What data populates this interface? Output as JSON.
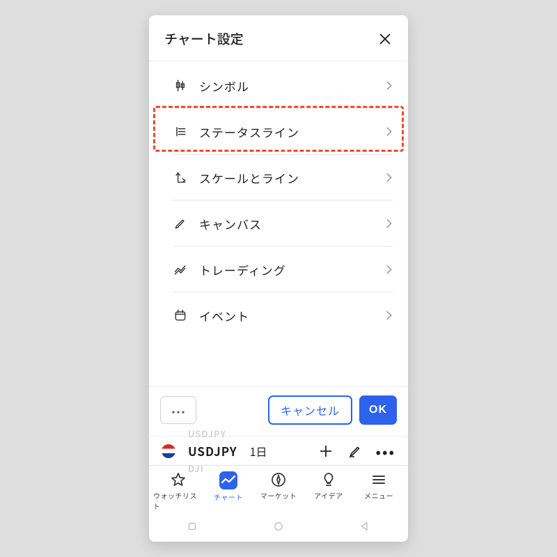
{
  "header": {
    "title": "チャート設定"
  },
  "settings": [
    {
      "label": "シンボル",
      "icon": "candlestick-icon"
    },
    {
      "label": "ステータスライン",
      "icon": "lines-icon"
    },
    {
      "label": "スケールとライン",
      "icon": "scales-icon"
    },
    {
      "label": "キャンバス",
      "icon": "pencil-icon"
    },
    {
      "label": "トレーディング",
      "icon": "trend-icon"
    },
    {
      "label": "イベント",
      "icon": "calendar-icon"
    }
  ],
  "highlight_index": 1,
  "footer": {
    "cancel_label": "キャンセル",
    "ok_label": "OK"
  },
  "chart_bar": {
    "symbol": "USDJPY",
    "timeframe": "1日",
    "ghost_symbol_top": "USDJPY",
    "ghost_symbol_bottom": "DJI"
  },
  "tabs": [
    {
      "label": "ウォッチリスト",
      "active": false
    },
    {
      "label": "チャート",
      "active": true
    },
    {
      "label": "マーケット",
      "active": false
    },
    {
      "label": "アイデア",
      "active": false
    },
    {
      "label": "メニュー",
      "active": false
    }
  ],
  "colors": {
    "accent": "#2d63ea",
    "highlight_border": "#ec4b2f"
  }
}
